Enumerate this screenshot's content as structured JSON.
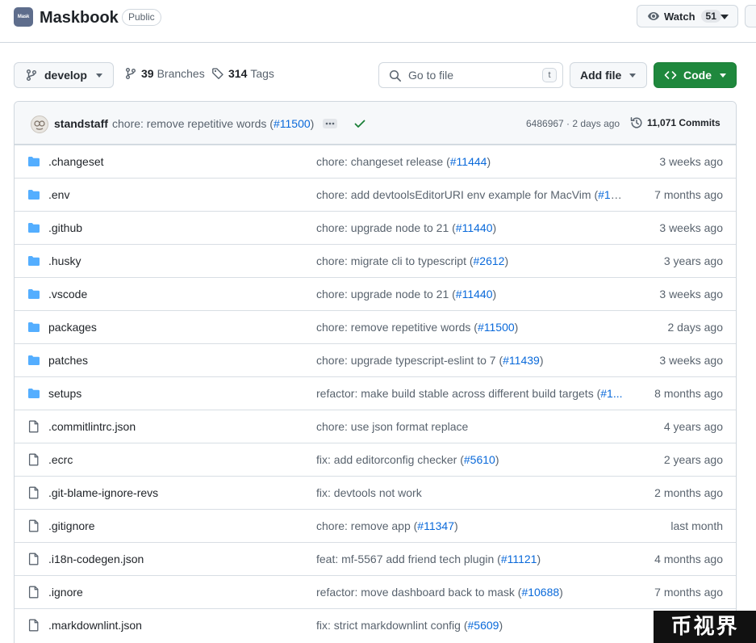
{
  "repo": {
    "avatar_text": "Mask",
    "name": "Maskbook",
    "visibility": "Public"
  },
  "watch": {
    "label": "Watch",
    "count": "51"
  },
  "toolbar": {
    "branch": "develop",
    "branches_count": "39",
    "branches_label": "Branches",
    "tags_count": "314",
    "tags_label": "Tags",
    "goto_placeholder": "Go to file",
    "goto_shortcut": "t",
    "add_file_label": "Add file",
    "code_label": "Code"
  },
  "latest_commit": {
    "author": "standstaff",
    "message": "chore: remove repetitive words (",
    "pr": "#11500",
    "message_end": ")",
    "hash_time": "6486967 · 2 days ago",
    "commits": "11,071 Commits"
  },
  "files": [
    {
      "type": "folder",
      "name": ".changeset",
      "msg": "chore: changeset release (",
      "pr": "#11444",
      "msg_end": ")",
      "date": "3 weeks ago"
    },
    {
      "type": "folder",
      "name": ".env",
      "msg": "chore: add devtoolsEditorURI env example for MacVim (",
      "pr": "#10...",
      "msg_end": "",
      "date": "7 months ago"
    },
    {
      "type": "folder",
      "name": ".github",
      "msg": "chore: upgrade node to 21 (",
      "pr": "#11440",
      "msg_end": ")",
      "date": "3 weeks ago"
    },
    {
      "type": "folder",
      "name": ".husky",
      "msg": "chore: migrate cli to typescript (",
      "pr": "#2612",
      "msg_end": ")",
      "date": "3 years ago"
    },
    {
      "type": "folder",
      "name": ".vscode",
      "msg": "chore: upgrade node to 21 (",
      "pr": "#11440",
      "msg_end": ")",
      "date": "3 weeks ago"
    },
    {
      "type": "folder",
      "name": "packages",
      "msg": "chore: remove repetitive words (",
      "pr": "#11500",
      "msg_end": ")",
      "date": "2 days ago"
    },
    {
      "type": "folder",
      "name": "patches",
      "msg": "chore: upgrade typescript-eslint to 7 (",
      "pr": "#11439",
      "msg_end": ")",
      "date": "3 weeks ago"
    },
    {
      "type": "folder",
      "name": "setups",
      "msg": "refactor: make build stable across different build targets (",
      "pr": "#1...",
      "msg_end": "",
      "date": "8 months ago"
    },
    {
      "type": "file",
      "name": ".commitlintrc.json",
      "msg": "chore: use json format replace",
      "pr": "",
      "msg_end": "",
      "date": "4 years ago"
    },
    {
      "type": "file",
      "name": ".ecrc",
      "msg": "fix: add editorconfig checker (",
      "pr": "#5610",
      "msg_end": ")",
      "date": "2 years ago"
    },
    {
      "type": "file",
      "name": ".git-blame-ignore-revs",
      "msg": "fix: devtools not work",
      "pr": "",
      "msg_end": "",
      "date": "2 months ago"
    },
    {
      "type": "file",
      "name": ".gitignore",
      "msg": "chore: remove app (",
      "pr": "#11347",
      "msg_end": ")",
      "date": "last month"
    },
    {
      "type": "file",
      "name": ".i18n-codegen.json",
      "msg": "feat: mf-5567 add friend tech plugin (",
      "pr": "#11121",
      "msg_end": ")",
      "date": "4 months ago"
    },
    {
      "type": "file",
      "name": ".ignore",
      "msg": "refactor: move dashboard back to mask (",
      "pr": "#10688",
      "msg_end": ")",
      "date": "7 months ago"
    },
    {
      "type": "file",
      "name": ".markdownlint.json",
      "msg": "fix: strict markdownlint config (",
      "pr": "#5609",
      "msg_end": ")",
      "date": ""
    }
  ],
  "colors": {
    "folder": "#54aeff",
    "link": "#0969da",
    "code_button": "#1f883d",
    "check": "#1a7f37"
  },
  "watermark": "币视界"
}
